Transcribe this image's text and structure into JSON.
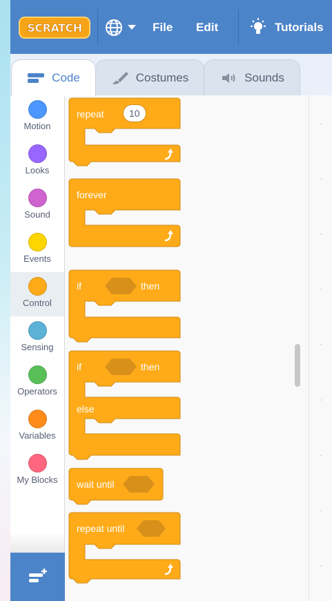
{
  "menubar": {
    "logo": "SCRATCH",
    "file": "File",
    "edit": "Edit",
    "tutorials": "Tutorials"
  },
  "tabs": [
    {
      "label": "Code",
      "icon": "code-icon"
    },
    {
      "label": "Costumes",
      "icon": "paintbrush-icon"
    },
    {
      "label": "Sounds",
      "icon": "speaker-icon"
    }
  ],
  "categories": [
    {
      "label": "Motion",
      "color": "#4c97ff"
    },
    {
      "label": "Looks",
      "color": "#9966ff"
    },
    {
      "label": "Sound",
      "color": "#cf63cf"
    },
    {
      "label": "Events",
      "color": "#ffd500"
    },
    {
      "label": "Control",
      "color": "#ffab19"
    },
    {
      "label": "Sensing",
      "color": "#5cb1d6"
    },
    {
      "label": "Operators",
      "color": "#59c059"
    },
    {
      "label": "Variables",
      "color": "#ff8c1a"
    },
    {
      "label": "My Blocks",
      "color": "#ff6680"
    }
  ],
  "selected_category": "Control",
  "blocks": {
    "repeat": {
      "label": "repeat",
      "count": "10"
    },
    "forever": {
      "label": "forever"
    },
    "if_then": {
      "if": "if",
      "then": "then"
    },
    "if_then_else": {
      "if": "if",
      "then": "then",
      "else": "else"
    },
    "wait_until": {
      "label": "wait until"
    },
    "repeat_until": {
      "label": "repeat until"
    }
  },
  "colors": {
    "control_block": "#ffab19",
    "control_border": "#cf8b17",
    "menubar": "#4c84c9"
  }
}
